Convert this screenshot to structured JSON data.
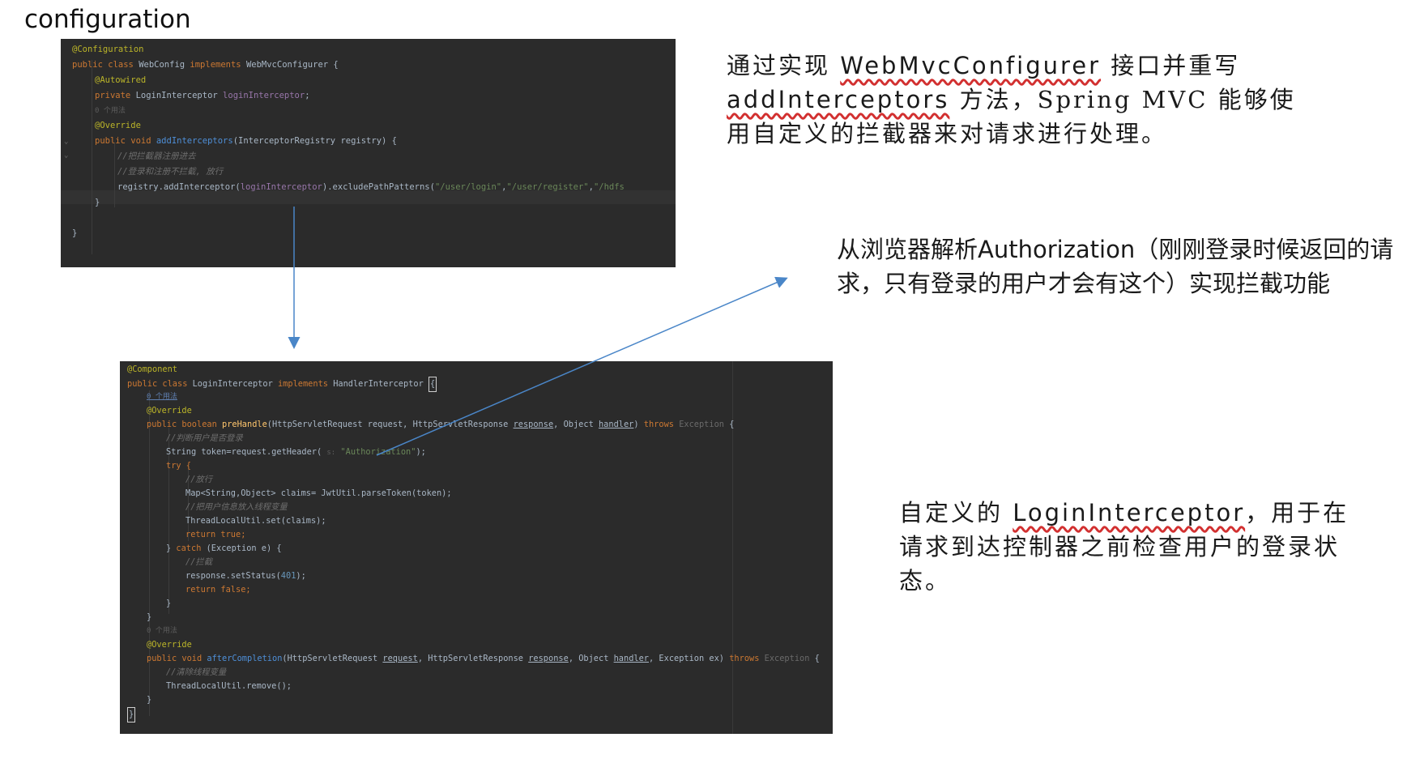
{
  "heading": "configuration",
  "code1": {
    "lines": [
      [
        "@Configuration"
      ],
      [
        "public class WebConfig implements WebMvcConfigurer {"
      ],
      [
        "@Autowired"
      ],
      [
        "private LoginInterceptor loginInterceptor;"
      ],
      [
        "0 个用法"
      ],
      [
        "@Override"
      ],
      [
        "public void addInterceptors(InterceptorRegistry registry) {"
      ],
      [
        "//把拦截器注册进去"
      ],
      [
        "//登录和注册不拦截, 放行"
      ],
      [
        "registry.addInterceptor(loginInterceptor).excludePathPatterns(\"/user/login\",\"/user/register\",\"/hdfs"
      ],
      [
        "}"
      ],
      [
        "}"
      ]
    ]
  },
  "code2": {
    "t": {
      "component": "@Component",
      "cls_public": "public class ",
      "cls_name": "LoginInterceptor ",
      "cls_impl": "implements ",
      "cls_iface": "HandlerInterceptor ",
      "cls_brace": "{",
      "usage1": "0 个用法",
      "override": "@Override",
      "pre_kw": "public boolean ",
      "pre_name": "preHandle",
      "pre_args1": "(HttpServletRequest request, HttpServletResponse ",
      "pre_response": "response",
      "pre_args2": ", Object ",
      "pre_handler": "handler",
      "pre_args3": ") ",
      "throws": "throws ",
      "exception": "Exception ",
      "open": "{",
      "c_judge": "//判断用户是否登录",
      "token_a": "String token=request.getHeader( ",
      "token_hint": "s:",
      "token_str": " \"Authorization\"",
      "token_b": ");",
      "try": "try {",
      "c_pass": "//放行",
      "claims": "Map<String,Object> claims= JwtUtil.parseToken(token);",
      "c_store": "//把用户信息放入线程变量",
      "tl_set": "ThreadLocalUtil.set(claims);",
      "return_true": "return true;",
      "catch_a": "} ",
      "catch_kw": "catch ",
      "catch_b": "(Exception e) {",
      "c_block": "//拦截",
      "status_a": "response.setStatus(",
      "status_num": "401",
      "status_b": ");",
      "return_false": "return false;",
      "close": "}",
      "usage2": "0 个用法",
      "after_kw": "public void ",
      "after_name": "afterCompletion",
      "after_args1": "(HttpServletRequest ",
      "after_request": "request",
      "after_args2": ", HttpServletResponse ",
      "after_response": "response",
      "after_args3": ", Object ",
      "after_handler": "handler",
      "after_args4": ", Exception ex) ",
      "c_clear": "//清除线程变量",
      "tl_remove": "ThreadLocalUtil.remove();"
    }
  },
  "notes": {
    "n1_a": "通过实现 ",
    "n1_b": "WebMvcConfigurer",
    "n1_c": " 接口并重写",
    "n1_d": "addInterceptors",
    "n1_e": " 方法，Spring MVC 能够使用自定义的拦截器来对请求进行处理。",
    "n2": "从浏览器解析Authorization（刚刚登录时候返回的请求，只有登录的用户才会有这个）实现拦截功能",
    "n3_a": "自定义的 ",
    "n3_b": "LoginInterceptor",
    "n3_c": "，用于在请求到达控制器之前检查用户的登录状态。"
  },
  "colors": {
    "arrow": "#4a86c8",
    "editor_bg": "#2b2b2b"
  }
}
